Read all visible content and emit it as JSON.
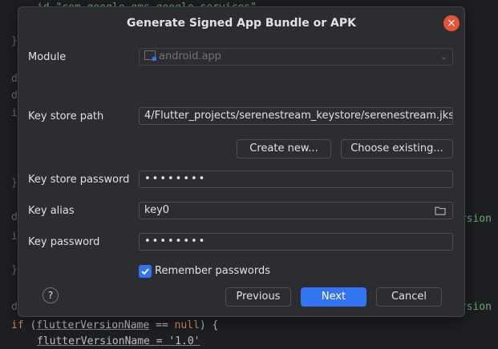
{
  "editor": {
    "top_line": "id \"com.google.gms.google-services\"",
    "brace1": "}",
    "frag_d1": "d",
    "frag_d2": "d",
    "frag_i1": "i",
    "brace2": "}",
    "frag_d3": "d",
    "frag_i2": "i",
    "brace3": "}",
    "frag_d4": "d",
    "right_frag1": "ersion",
    "right_frag2": "ersion",
    "if_kw": "if",
    "if_paren_open": " (",
    "if_ident": "flutterVersionName",
    "if_op": " == ",
    "if_null": "null",
    "if_close": ") {",
    "bottom_line": "flutterVersionName = '1.0'"
  },
  "dialog": {
    "title": "Generate Signed App Bundle or APK",
    "module_label": "Module",
    "module_value": "android.app",
    "keystore_path_label": "Key store path",
    "keystore_path_value": "4/Flutter_projects/serenestream_keystore/serenestream.jks",
    "create_new_label": "Create new...",
    "choose_existing_label": "Choose existing...",
    "keystore_password_label": "Key store password",
    "keystore_password_value": "••••••••",
    "key_alias_label": "Key alias",
    "key_alias_value": "key0",
    "key_password_label": "Key password",
    "key_password_value": "••••••••",
    "remember_label": "Remember passwords",
    "remember_checked": true,
    "help_symbol": "?",
    "previous_label": "Previous",
    "next_label": "Next",
    "cancel_label": "Cancel",
    "close_symbol": "×"
  },
  "colors": {
    "accent": "#3574f0",
    "close": "#e5533a",
    "dialog_bg": "#2b2d30",
    "editor_bg": "#1e1f22"
  }
}
